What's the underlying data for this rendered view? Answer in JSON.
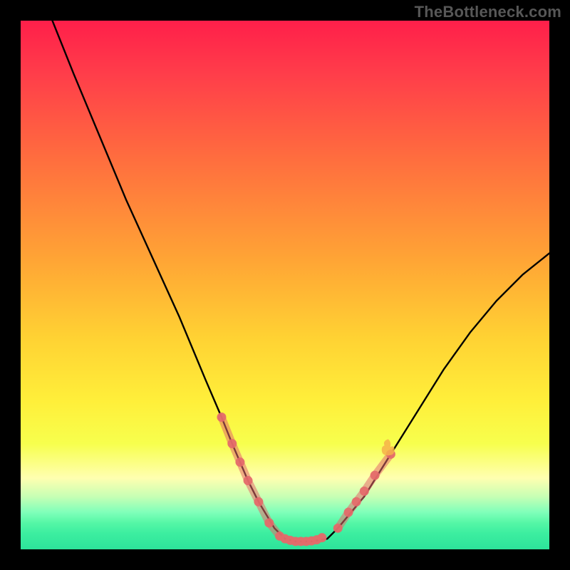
{
  "watermark": "TheBottleneck.com",
  "chart_data": {
    "type": "line",
    "title": "",
    "xlabel": "",
    "ylabel": "",
    "xlim": [
      0,
      100
    ],
    "ylim": [
      0,
      100
    ],
    "grid": false,
    "legend": false,
    "series": [
      {
        "name": "bottleneck-curve",
        "x": [
          6,
          10,
          15,
          20,
          25,
          30,
          35,
          38,
          40,
          43,
          45,
          48,
          50,
          52,
          55,
          58,
          60,
          65,
          70,
          75,
          80,
          85,
          90,
          95,
          100
        ],
        "y": [
          100,
          90,
          78,
          66,
          55,
          44,
          32,
          25,
          20,
          13,
          9,
          4,
          2,
          1.5,
          1.5,
          2,
          4,
          10,
          18,
          26,
          34,
          41,
          47,
          52,
          56
        ],
        "color": "#000000"
      }
    ],
    "marker_clusters": [
      {
        "name": "left-cluster",
        "color": "#e46a6a",
        "points": [
          {
            "x": 38.0,
            "y": 25.0
          },
          {
            "x": 40.0,
            "y": 20.0
          },
          {
            "x": 41.5,
            "y": 16.5
          },
          {
            "x": 43.0,
            "y": 13.0
          },
          {
            "x": 45.0,
            "y": 9.0
          },
          {
            "x": 47.0,
            "y": 5.0
          },
          {
            "x": 49.0,
            "y": 2.5
          }
        ]
      },
      {
        "name": "bottom-cluster",
        "color": "#e46a6a",
        "points": [
          {
            "x": 50.0,
            "y": 2.0
          },
          {
            "x": 51.0,
            "y": 1.7
          },
          {
            "x": 52.0,
            "y": 1.5
          },
          {
            "x": 53.0,
            "y": 1.5
          },
          {
            "x": 54.0,
            "y": 1.5
          },
          {
            "x": 55.0,
            "y": 1.6
          },
          {
            "x": 56.0,
            "y": 1.8
          },
          {
            "x": 57.0,
            "y": 2.2
          }
        ]
      },
      {
        "name": "right-cluster",
        "color": "#e46a6a",
        "points": [
          {
            "x": 60.0,
            "y": 4.0
          },
          {
            "x": 62.0,
            "y": 7.0
          },
          {
            "x": 63.5,
            "y": 9.0
          },
          {
            "x": 65.0,
            "y": 11.0
          },
          {
            "x": 67.0,
            "y": 14.0
          },
          {
            "x": 70.0,
            "y": 18.0
          }
        ]
      }
    ],
    "annotations": [
      {
        "name": "flame-accent",
        "x": 69.5,
        "y": 19.5,
        "color": "#f6b24a"
      }
    ],
    "background": {
      "type": "vertical-gradient",
      "stops": [
        {
          "pos": 0.0,
          "color": "#ff1f4a"
        },
        {
          "pos": 0.45,
          "color": "#ffa435"
        },
        {
          "pos": 0.8,
          "color": "#f7ff4d"
        },
        {
          "pos": 0.9,
          "color": "#c7ffb4"
        },
        {
          "pos": 1.0,
          "color": "#2de39a"
        }
      ]
    }
  }
}
